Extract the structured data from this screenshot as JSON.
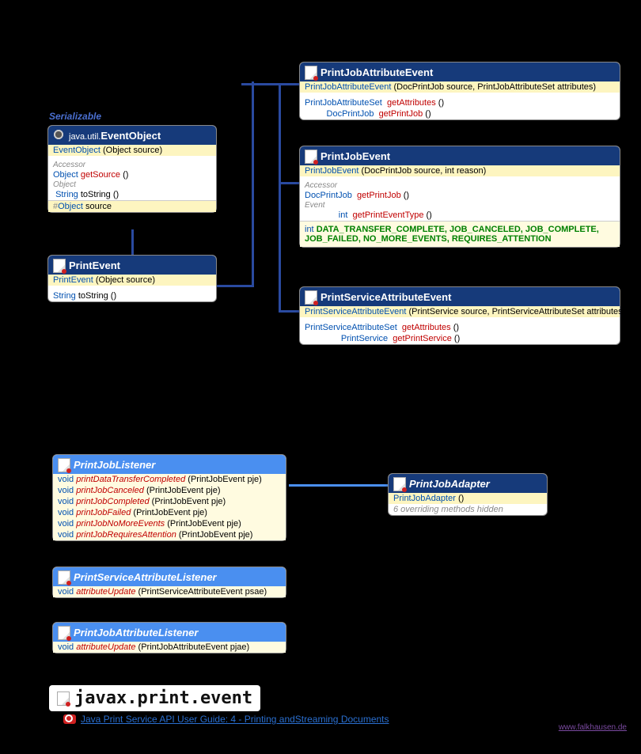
{
  "stereotype": "Serializable",
  "eventObject": {
    "pkg": "java.util.",
    "name": "EventObject",
    "ctor": "EventObject",
    "ctorParam": "(Object source)",
    "accessor": "Accessor",
    "m1_ret": "Object",
    "m1": "getSource",
    "m1p": "()",
    "objLabel": "Object",
    "m2_ret": "String",
    "m2": "toString",
    "m2p": "()",
    "field_hash": "#",
    "field_type": "Object",
    "field_name": "source"
  },
  "printEvent": {
    "name": "PrintEvent",
    "ctor": "PrintEvent",
    "ctorParam": "(Object source)",
    "m1_ret": "String",
    "m1": "toString",
    "m1p": "()"
  },
  "printJobAttrEvent": {
    "name": "PrintJobAttributeEvent",
    "ctor": "PrintJobAttributeEvent",
    "ctorParam": "(DocPrintJob source, PrintJobAttributeSet attributes)",
    "m1_ret": "PrintJobAttributeSet",
    "m1": "getAttributes",
    "m1p": "()",
    "m2_ret": "DocPrintJob",
    "m2": "getPrintJob",
    "m2p": "()"
  },
  "printJobEvent": {
    "name": "PrintJobEvent",
    "ctor": "PrintJobEvent",
    "ctorParam": "(DocPrintJob source, int reason)",
    "accessor": "Accessor",
    "m1_ret": "DocPrintJob",
    "m1": "getPrintJob",
    "m1p": "()",
    "eventLabel": "Event",
    "m2_ret": "int",
    "m2": "getPrintEventType",
    "m2p": "()",
    "const_type": "int",
    "constants": "DATA_TRANSFER_COMPLETE, JOB_CANCELED, JOB_COMPLETE, JOB_FAILED, NO_MORE_EVENTS, REQUIRES_ATTENTION"
  },
  "printServiceAttrEvent": {
    "name": "PrintServiceAttributeEvent",
    "ctor": "PrintServiceAttributeEvent",
    "ctorParam": "(PrintService source, PrintServiceAttributeSet attributes)",
    "m1_ret": "PrintServiceAttributeSet",
    "m1": "getAttributes",
    "m1p": "()",
    "m2_ret": "PrintService",
    "m2": "getPrintService",
    "m2p": "()"
  },
  "printJobListener": {
    "name": "PrintJobListener",
    "rows": [
      {
        "ret": "void",
        "m": "printDataTransferCompleted",
        "p": "(PrintJobEvent pje)"
      },
      {
        "ret": "void",
        "m": "printJobCanceled",
        "p": "(PrintJobEvent pje)"
      },
      {
        "ret": "void",
        "m": "printJobCompleted",
        "p": "(PrintJobEvent pje)"
      },
      {
        "ret": "void",
        "m": "printJobFailed",
        "p": "(PrintJobEvent pje)"
      },
      {
        "ret": "void",
        "m": "printJobNoMoreEvents",
        "p": "(PrintJobEvent pje)"
      },
      {
        "ret": "void",
        "m": "printJobRequiresAttention",
        "p": "(PrintJobEvent pje)"
      }
    ]
  },
  "printJobAdapter": {
    "name": "PrintJobAdapter",
    "ctor": "PrintJobAdapter",
    "ctorParam": "()",
    "hidden": "6 overriding methods hidden"
  },
  "printServiceAttrListener": {
    "name": "PrintServiceAttributeListener",
    "ret": "void",
    "m": "attributeUpdate",
    "p": "(PrintServiceAttributeEvent psae)"
  },
  "printJobAttrListener": {
    "name": "PrintJobAttributeListener",
    "ret": "void",
    "m": "attributeUpdate",
    "p": "(PrintJobAttributeEvent pjae)"
  },
  "packageName": "javax.print.event",
  "guideLink": "Java Print Service API User Guide: 4 - Printing andStreaming Documents",
  "footerUrl": "www.falkhausen.de"
}
